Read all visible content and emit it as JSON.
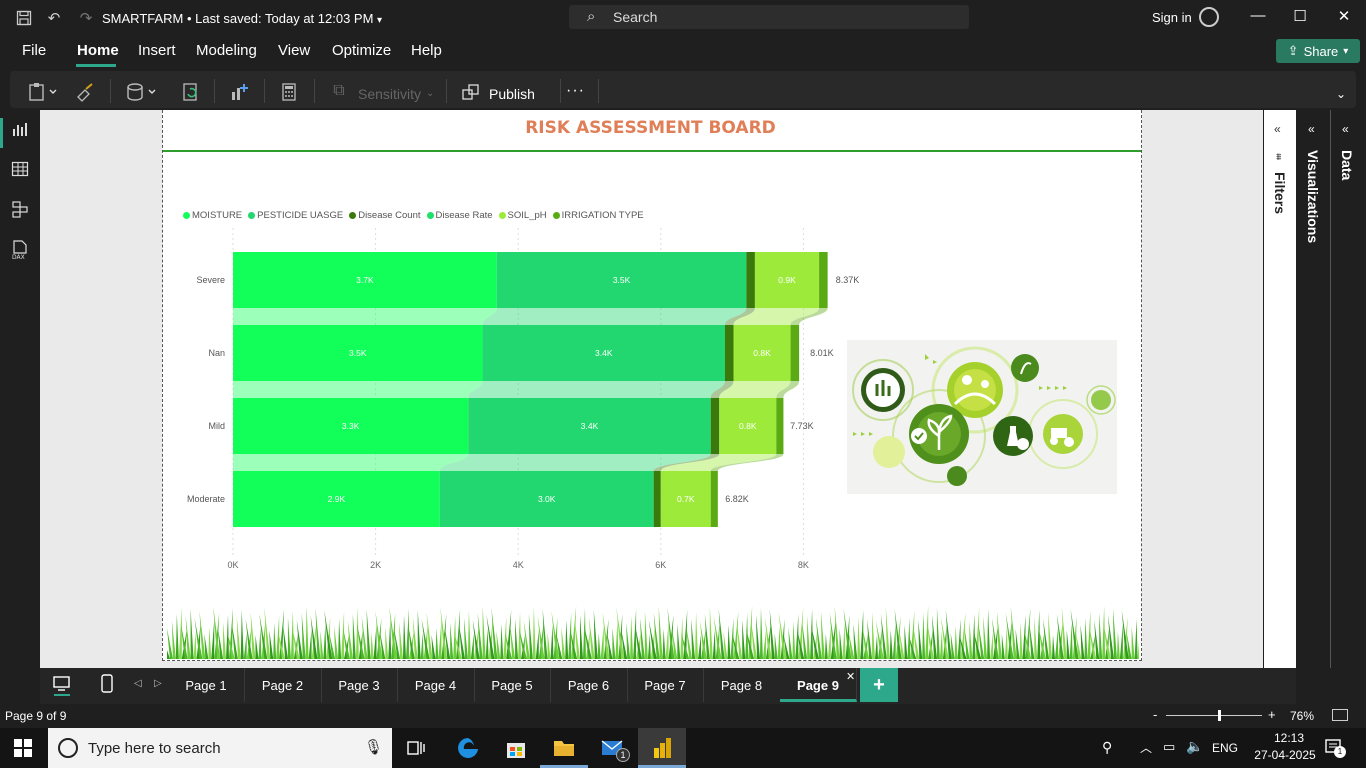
{
  "titlebar": {
    "app_title": "SMARTFARM • Last saved: Today at 12:03 PM",
    "search_placeholder": "Search",
    "sign_in": "Sign in"
  },
  "menu": {
    "items": [
      "File",
      "Home",
      "Insert",
      "Modeling",
      "View",
      "Optimize",
      "Help"
    ],
    "active": "Home",
    "share_label": "Share"
  },
  "ribbon": {
    "sensitivity_label": "Sensitivity",
    "publish_label": "Publish",
    "more_label": "···"
  },
  "report": {
    "title": "RISK ASSESSMENT BOARD"
  },
  "chart_data": {
    "type": "bar",
    "orientation": "horizontal",
    "stacked": true,
    "categories": [
      "Severe",
      "Nan",
      "Mild",
      "Moderate"
    ],
    "series": [
      {
        "name": "MOISTURE",
        "color": "#12ff5a",
        "values": [
          3.7,
          3.5,
          3.3,
          2.9
        ],
        "labels": [
          "3.7K",
          "3.5K",
          "3.3K",
          "2.9K"
        ]
      },
      {
        "name": "PESTICIDE UASGE",
        "color": "#22d670",
        "values": [
          3.5,
          3.4,
          3.4,
          3.0
        ],
        "labels": [
          "3.5K",
          "3.4K",
          "3.4K",
          "3.0K"
        ]
      },
      {
        "name": "Disease Count",
        "color": "#3a7a0c",
        "values": [
          0.12,
          0.12,
          0.12,
          0.1
        ],
        "labels": [
          "",
          "",
          "",
          ""
        ]
      },
      {
        "name": "Disease Rate",
        "color": "#1ee06a",
        "values": [
          0,
          0,
          0,
          0
        ],
        "labels": [
          "",
          "",
          "",
          ""
        ]
      },
      {
        "name": "SOIL_pH",
        "color": "#9eea3a",
        "values": [
          0.9,
          0.8,
          0.8,
          0.7
        ],
        "labels": [
          "0.9K",
          "0.8K",
          "0.8K",
          "0.7K"
        ]
      },
      {
        "name": "IRRIGATION TYPE",
        "color": "#5aaa14",
        "values": [
          0.12,
          0.12,
          0.1,
          0.1
        ],
        "labels": [
          "",
          "",
          "",
          ""
        ]
      }
    ],
    "totals": [
      "8.37K",
      "8.01K",
      "7.73K",
      "6.82K"
    ],
    "total_values": [
      8.37,
      8.01,
      7.73,
      6.82
    ],
    "x_ticks": [
      "0K",
      "2K",
      "4K",
      "6K",
      "8K"
    ],
    "xlim": [
      0,
      8
    ],
    "grid": true,
    "legend_position": "top-left"
  },
  "panes": {
    "filters_label": "Filters",
    "visualizations_label": "Visualizations",
    "data_label": "Data"
  },
  "pages": {
    "tabs": [
      "Page 1",
      "Page 2",
      "Page 3",
      "Page 4",
      "Page 5",
      "Page 6",
      "Page 7",
      "Page 8",
      "Page 9"
    ],
    "active": "Page 9",
    "add_label": "+"
  },
  "status": {
    "page_indicator": "Page 9 of 9",
    "zoom_minus": "-",
    "zoom_plus": "+",
    "zoom_level": "76%",
    "zoom_fraction": 0.55
  },
  "taskbar": {
    "search_placeholder": "Type here to search",
    "lang": "ENG",
    "time": "12:13",
    "date": "27-04-2025",
    "mail_badge": "1",
    "notif_badge": "1"
  }
}
